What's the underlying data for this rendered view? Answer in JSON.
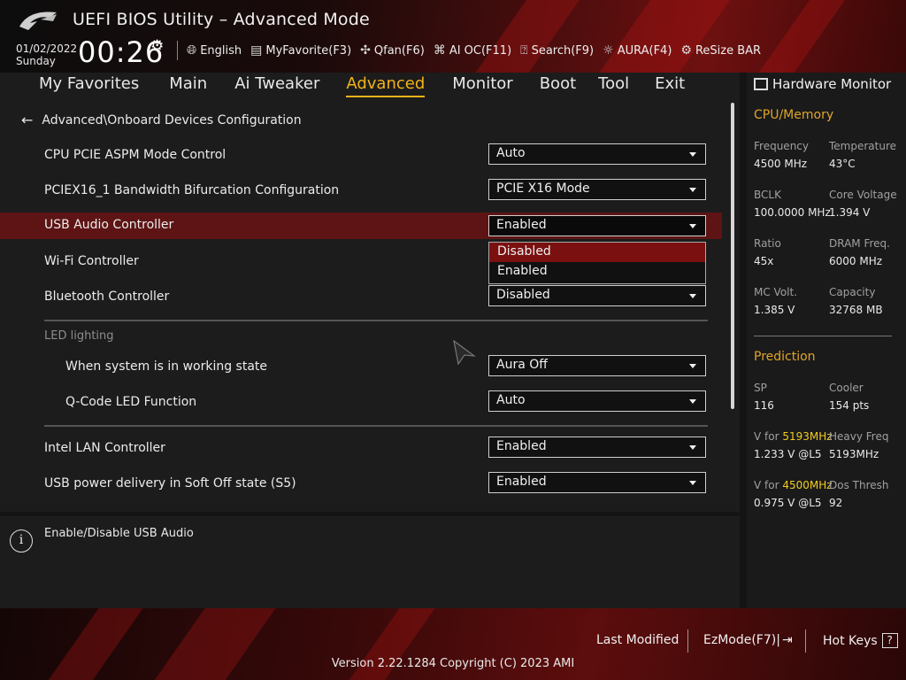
{
  "header": {
    "title": "UEFI BIOS Utility – Advanced Mode",
    "date": "01/02/2022",
    "day": "Sunday",
    "time": "00:26",
    "toolbar": [
      {
        "label": "English",
        "icon": "globe-icon"
      },
      {
        "label": "MyFavorite(F3)",
        "icon": "favorite-icon"
      },
      {
        "label": "Qfan(F6)",
        "icon": "fan-icon"
      },
      {
        "label": "AI OC(F11)",
        "icon": "ai-chip-icon"
      },
      {
        "label": "Search(F9)",
        "icon": "search-icon"
      },
      {
        "label": "AURA(F4)",
        "icon": "aura-icon"
      },
      {
        "label": "ReSize BAR",
        "icon": "resize-bar-icon"
      }
    ]
  },
  "nav": {
    "tabs": [
      "My Favorites",
      "Main",
      "Ai Tweaker",
      "Advanced",
      "Monitor",
      "Boot",
      "Tool",
      "Exit"
    ],
    "active": "Advanced"
  },
  "breadcrumb": "Advanced\\Onboard Devices Configuration",
  "settings": [
    {
      "label": "CPU PCIE ASPM Mode Control",
      "value": "Auto"
    },
    {
      "label": "PCIEX16_1 Bandwidth Bifurcation Configuration",
      "value": "PCIE X16 Mode"
    },
    {
      "label": "USB Audio Controller",
      "value": "Enabled"
    },
    {
      "label": "Wi-Fi Controller",
      "value": ""
    },
    {
      "label": "Bluetooth Controller",
      "value": "Disabled"
    },
    {
      "label": "When system is in working state",
      "value": "Aura Off"
    },
    {
      "label": "Q-Code LED Function",
      "value": "Auto"
    },
    {
      "label": "Intel LAN Controller",
      "value": "Enabled"
    },
    {
      "label": "USB power delivery in Soft Off state (S5)",
      "value": "Enabled"
    }
  ],
  "led_section_label": "LED lighting",
  "dropdown_options": [
    "Disabled",
    "Enabled"
  ],
  "help_text": "Enable/Disable USB Audio",
  "hw_monitor": {
    "title": "Hardware Monitor",
    "cpu_memory": {
      "heading": "CPU/Memory",
      "items": [
        {
          "label": "Frequency",
          "value": "4500 MHz"
        },
        {
          "label": "Temperature",
          "value": "43°C"
        },
        {
          "label": "BCLK",
          "value": "100.0000 MHz"
        },
        {
          "label": "Core Voltage",
          "value": "1.394 V"
        },
        {
          "label": "Ratio",
          "value": "45x"
        },
        {
          "label": "DRAM Freq.",
          "value": "6000 MHz"
        },
        {
          "label": "MC Volt.",
          "value": "1.385 V"
        },
        {
          "label": "Capacity",
          "value": "32768 MB"
        }
      ]
    },
    "prediction": {
      "heading": "Prediction",
      "sp_label": "SP",
      "sp_value": "116",
      "cooler_label": "Cooler",
      "cooler_value": "154 pts",
      "v_for_1_prefix": "V for ",
      "v_for_1_freq": "5193MHz",
      "v_for_1_value": "1.233 V @L5",
      "heavy_freq_label": "Heavy Freq",
      "heavy_freq_value": "5193MHz",
      "v_for_2_prefix": "V for ",
      "v_for_2_freq": "4500MHz",
      "v_for_2_value": "0.975 V @L5",
      "dos_thresh_label": "Dos Thresh",
      "dos_thresh_value": "92"
    }
  },
  "footer": {
    "last_modified": "Last Modified",
    "ezmode": "EzMode(F7)|",
    "hotkeys": "Hot Keys",
    "hotkeys_key": "?",
    "version": "Version 2.22.1284 Copyright (C) 2023 AMI"
  },
  "colors": {
    "accent": "#f2b318",
    "selected_row": "#5e1414",
    "highlight_option": "#7a1010",
    "prediction_highlight": "#f2cc20"
  }
}
